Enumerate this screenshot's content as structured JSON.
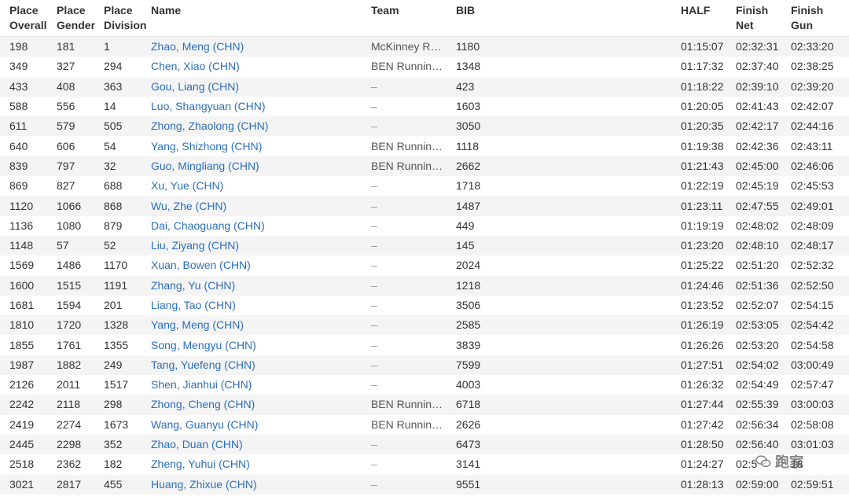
{
  "headers": {
    "place_overall": [
      "Place",
      "Overall"
    ],
    "place_gender": [
      "Place",
      "Gender"
    ],
    "place_division": [
      "Place",
      "Division"
    ],
    "name": "Name",
    "team": "Team",
    "bib": "BIB",
    "half": "HALF",
    "finish_net": [
      "Finish",
      "Net"
    ],
    "finish_gun": [
      "Finish",
      "Gun"
    ]
  },
  "rows": [
    {
      "overall": "198",
      "gender": "181",
      "division": "1",
      "name": "Zhao, Meng (CHN)",
      "team": "McKinney Running...",
      "bib": "1180",
      "half": "01:15:07",
      "net": "02:32:31",
      "gun": "02:33:20"
    },
    {
      "overall": "349",
      "gender": "327",
      "division": "294",
      "name": "Chen, Xiao (CHN)",
      "team": "BEN Running...",
      "bib": "1348",
      "half": "01:17:32",
      "net": "02:37:40",
      "gun": "02:38:25"
    },
    {
      "overall": "433",
      "gender": "408",
      "division": "363",
      "name": "Gou, Liang (CHN)",
      "team": "–",
      "bib": "423",
      "half": "01:18:22",
      "net": "02:39:10",
      "gun": "02:39:20"
    },
    {
      "overall": "588",
      "gender": "556",
      "division": "14",
      "name": "Luo, Shangyuan (CHN)",
      "team": "–",
      "bib": "1603",
      "half": "01:20:05",
      "net": "02:41:43",
      "gun": "02:42:07"
    },
    {
      "overall": "611",
      "gender": "579",
      "division": "505",
      "name": "Zhong, Zhaolong (CHN)",
      "team": "–",
      "bib": "3050",
      "half": "01:20:35",
      "net": "02:42:17",
      "gun": "02:44:16"
    },
    {
      "overall": "640",
      "gender": "606",
      "division": "54",
      "name": "Yang, Shizhong (CHN)",
      "team": "BEN Running...",
      "bib": "1118",
      "half": "01:19:38",
      "net": "02:42:36",
      "gun": "02:43:11"
    },
    {
      "overall": "839",
      "gender": "797",
      "division": "32",
      "name": "Guo, Mingliang (CHN)",
      "team": "BEN Running...",
      "bib": "2662",
      "half": "01:21:43",
      "net": "02:45:00",
      "gun": "02:46:06"
    },
    {
      "overall": "869",
      "gender": "827",
      "division": "688",
      "name": "Xu, Yue (CHN)",
      "team": "–",
      "bib": "1718",
      "half": "01:22:19",
      "net": "02:45:19",
      "gun": "02:45:53"
    },
    {
      "overall": "1120",
      "gender": "1066",
      "division": "868",
      "name": "Wu, Zhe (CHN)",
      "team": "–",
      "bib": "1487",
      "half": "01:23:11",
      "net": "02:47:55",
      "gun": "02:49:01"
    },
    {
      "overall": "1136",
      "gender": "1080",
      "division": "879",
      "name": "Dai, Chaoguang (CHN)",
      "team": "–",
      "bib": "449",
      "half": "01:19:19",
      "net": "02:48:02",
      "gun": "02:48:09"
    },
    {
      "overall": "1148",
      "gender": "57",
      "division": "52",
      "name": "Liu, Ziyang (CHN)",
      "team": "–",
      "bib": "145",
      "half": "01:23:20",
      "net": "02:48:10",
      "gun": "02:48:17"
    },
    {
      "overall": "1569",
      "gender": "1486",
      "division": "1170",
      "name": "Xuan, Bowen (CHN)",
      "team": "–",
      "bib": "2024",
      "half": "01:25:22",
      "net": "02:51:20",
      "gun": "02:52:32"
    },
    {
      "overall": "1600",
      "gender": "1515",
      "division": "1191",
      "name": "Zhang, Yu (CHN)",
      "team": "–",
      "bib": "1218",
      "half": "01:24:46",
      "net": "02:51:36",
      "gun": "02:52:50"
    },
    {
      "overall": "1681",
      "gender": "1594",
      "division": "201",
      "name": "Liang, Tao (CHN)",
      "team": "–",
      "bib": "3506",
      "half": "01:23:52",
      "net": "02:52:07",
      "gun": "02:54:15"
    },
    {
      "overall": "1810",
      "gender": "1720",
      "division": "1328",
      "name": "Yang, Meng (CHN)",
      "team": "–",
      "bib": "2585",
      "half": "01:26:19",
      "net": "02:53:05",
      "gun": "02:54:42"
    },
    {
      "overall": "1855",
      "gender": "1761",
      "division": "1355",
      "name": "Song, Mengyu (CHN)",
      "team": "–",
      "bib": "3839",
      "half": "01:26:26",
      "net": "02:53:20",
      "gun": "02:54:58"
    },
    {
      "overall": "1987",
      "gender": "1882",
      "division": "249",
      "name": "Tang, Yuefeng (CHN)",
      "team": "–",
      "bib": "7599",
      "half": "01:27:51",
      "net": "02:54:02",
      "gun": "03:00:49"
    },
    {
      "overall": "2126",
      "gender": "2011",
      "division": "1517",
      "name": "Shen, Jianhui (CHN)",
      "team": "–",
      "bib": "4003",
      "half": "01:26:32",
      "net": "02:54:49",
      "gun": "02:57:47"
    },
    {
      "overall": "2242",
      "gender": "2118",
      "division": "298",
      "name": "Zhong, Cheng (CHN)",
      "team": "BEN Running...",
      "bib": "6718",
      "half": "01:27:44",
      "net": "02:55:39",
      "gun": "03:00:03"
    },
    {
      "overall": "2419",
      "gender": "2274",
      "division": "1673",
      "name": "Wang, Guanyu (CHN)",
      "team": "BEN Running...",
      "bib": "2626",
      "half": "01:27:42",
      "net": "02:56:34",
      "gun": "02:58:08"
    },
    {
      "overall": "2445",
      "gender": "2298",
      "division": "352",
      "name": "Zhao, Duan (CHN)",
      "team": "–",
      "bib": "6473",
      "half": "01:28:50",
      "net": "02:56:40",
      "gun": "03:01:03"
    },
    {
      "overall": "2518",
      "gender": "2362",
      "division": "182",
      "name": "Zheng, Yuhui (CHN)",
      "team": "–",
      "bib": "3141",
      "half": "01:24:27",
      "net": "02:5",
      "gun": "18"
    },
    {
      "overall": "3021",
      "gender": "2817",
      "division": "455",
      "name": "Huang, Zhixue (CHN)",
      "team": "–",
      "bib": "9551",
      "half": "01:28:13",
      "net": "02:59:00",
      "gun": "02:59:51"
    }
  ],
  "watermark": {
    "text": "跑家",
    "icon": "wechat-icon"
  }
}
